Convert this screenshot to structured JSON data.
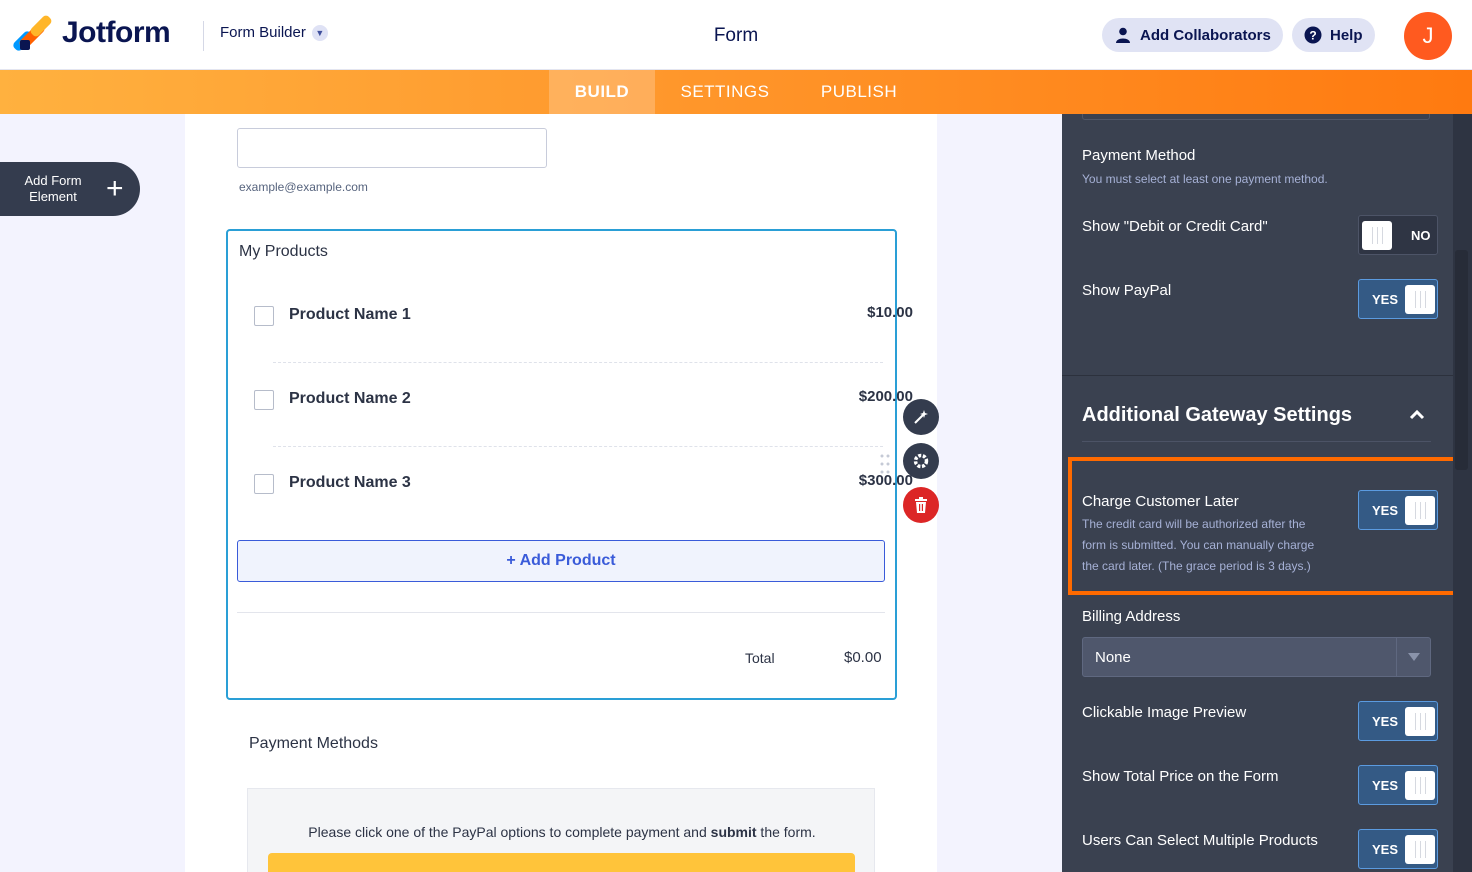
{
  "header": {
    "brand": "Jotform",
    "builder_label": "Form Builder",
    "form_title": "Form",
    "add_collaborators": "Add Collaborators",
    "help": "Help",
    "avatar_initial": "J"
  },
  "tabs": [
    {
      "label": "BUILD",
      "active": true
    },
    {
      "label": "SETTINGS",
      "active": false
    },
    {
      "label": "PUBLISH",
      "active": false
    }
  ],
  "left": {
    "add_form_element_line1": "Add Form",
    "add_form_element_line2": "Element"
  },
  "form": {
    "email_sublabel": "example@example.com",
    "products_title": "My Products",
    "products": [
      {
        "name": "Product Name 1",
        "price": "$10.00"
      },
      {
        "name": "Product Name 2",
        "price": "$200.00"
      },
      {
        "name": "Product Name 3",
        "price": "$300.00"
      }
    ],
    "add_product": "+ Add Product",
    "total_label": "Total",
    "total_value": "$0.00",
    "payment_methods_title": "Payment Methods",
    "paypal_note_before": "Please click one of the PayPal options to complete payment and ",
    "paypal_note_bold": "submit",
    "paypal_note_after": " the form."
  },
  "panel": {
    "payment_method_label": "Payment Method",
    "payment_method_sub": "You must select at least one payment method.",
    "show_card_label": "Show \"Debit or Credit Card\"",
    "show_card_value": "NO",
    "show_paypal_label": "Show PayPal",
    "show_paypal_value": "YES",
    "section_title": "Additional Gateway Settings",
    "charge_later_label": "Charge Customer Later",
    "charge_later_sub_1": "The credit card will be authorized after the",
    "charge_later_sub_2": "form is submitted. You can manually charge",
    "charge_later_sub_3": "the card later. (The grace period is 3 days.)",
    "charge_later_value": "YES",
    "billing_address_label": "Billing Address",
    "billing_address_value": "None",
    "clickable_preview_label": "Clickable Image Preview",
    "clickable_preview_value": "YES",
    "show_total_label": "Show Total Price on the Form",
    "show_total_value": "YES",
    "multi_products_label": "Users Can Select Multiple Products",
    "multi_products_value": "YES"
  },
  "colors": {
    "accent_orange": "#ff7a10",
    "highlight_border": "#ff6a00",
    "product_box_border": "#2a9fd6",
    "delete_red": "#dc2626"
  }
}
